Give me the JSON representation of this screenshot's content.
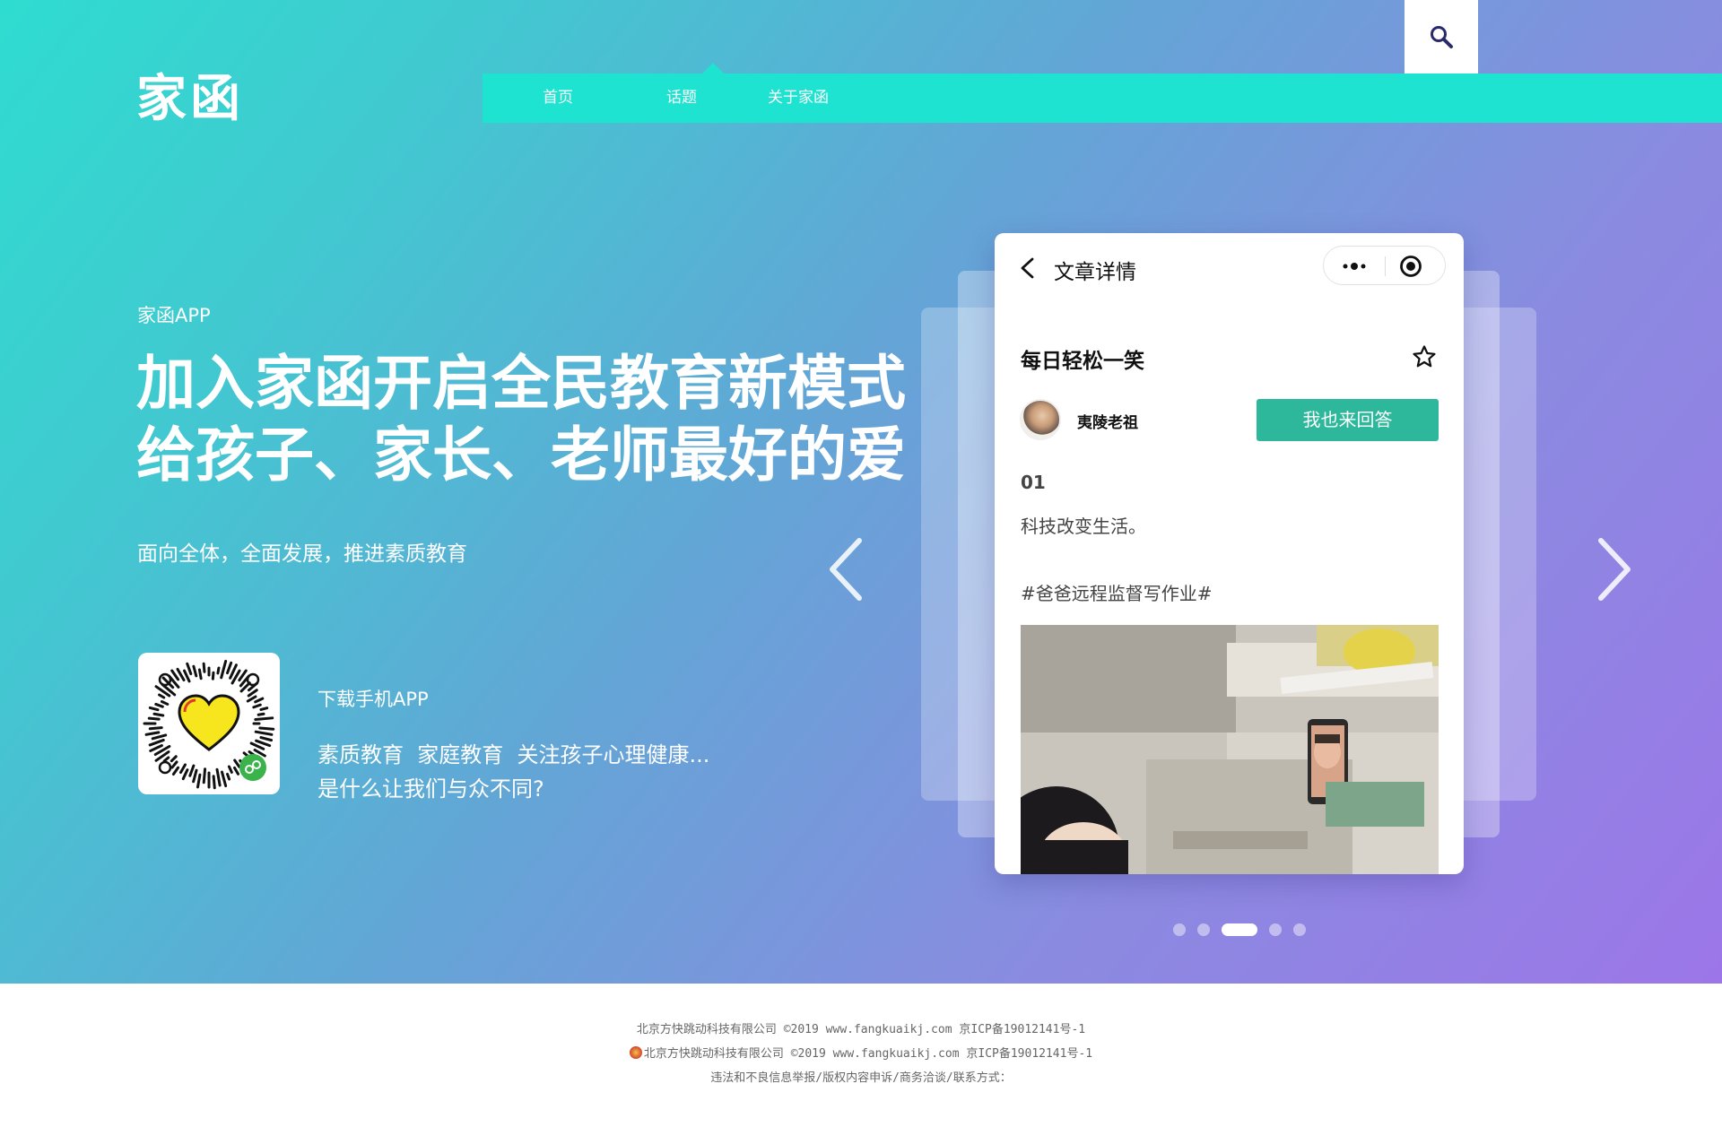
{
  "brand": {
    "logo_text": "家函"
  },
  "nav": {
    "items": [
      {
        "label": "首页"
      },
      {
        "label": "话题"
      },
      {
        "label": "关于家函"
      }
    ],
    "search_icon": "search-icon"
  },
  "hero": {
    "app_label": "家函APP",
    "headline_line1": "加入家函开启全民教育新模式",
    "headline_line2": "给孩子、家长、老师最好的爱",
    "subline": "面向全体，全面发展，推进素质教育"
  },
  "download": {
    "title": "下载手机APP",
    "line1": "素质教育  家庭教育  关注孩子心理健康...",
    "line2": "是什么让我们与众不同?",
    "qr_icon": "mini-program-qr-code"
  },
  "phone": {
    "header_title": "文章详情",
    "post_title": "每日轻松一笑",
    "author": "夷陵老祖",
    "answer_button": "我也来回答",
    "index": "01",
    "content": "科技改变生活。",
    "hashtag": "#爸爸远程监督写作业#"
  },
  "carousel": {
    "total_slides": 5,
    "active_index": 2
  },
  "colors": {
    "nav_bar": "#1fe3d1",
    "answer_button": "#2db89b",
    "gradient_start": "#2fdcd0",
    "gradient_end": "#9c76e8"
  },
  "footer": {
    "line1": "北京方快跳动科技有限公司 ©2019 www.fangkuaikj.com 京ICP备19012141号-1",
    "line2": "北京方快跳动科技有限公司 ©2019 www.fangkuaikj.com 京ICP备19012141号-1",
    "line3": "违法和不良信息举报/版权内容申诉/商务洽谈/联系方式："
  }
}
